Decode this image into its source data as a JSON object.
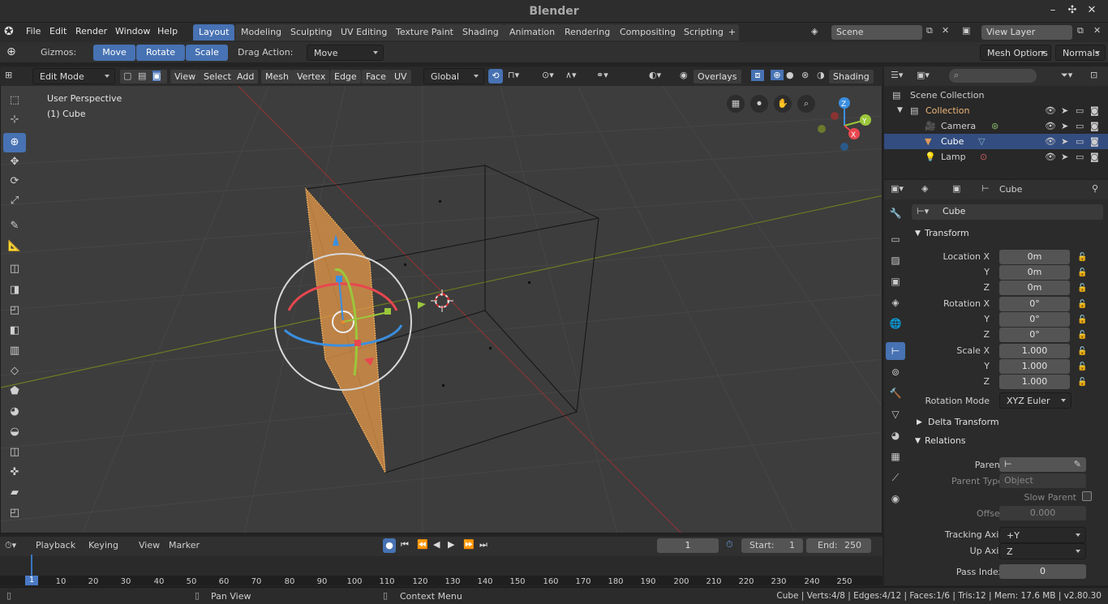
{
  "app": {
    "title": "Blender"
  },
  "menubar": {
    "items": [
      "File",
      "Edit",
      "Render",
      "Window",
      "Help"
    ]
  },
  "workspaces": [
    {
      "label": "Layout",
      "active": true
    },
    {
      "label": "Modeling"
    },
    {
      "label": "Sculpting"
    },
    {
      "label": "UV Editing"
    },
    {
      "label": "Texture Paint"
    },
    {
      "label": "Shading"
    },
    {
      "label": "Animation"
    },
    {
      "label": "Rendering"
    },
    {
      "label": "Compositing"
    },
    {
      "label": "Scripting"
    }
  ],
  "scene": {
    "name": "Scene",
    "view_layer": "View Layer"
  },
  "toolheader": {
    "gizmos_label": "Gizmos:",
    "move": "Move",
    "rotate": "Rotate",
    "scale": "Scale",
    "drag_label": "Drag Action:",
    "drag_value": "Move",
    "mesh_options": "Mesh Options",
    "normals": "Normals"
  },
  "viewport_header": {
    "mode": "Edit Mode",
    "menus": [
      "View",
      "Select",
      "Add",
      "Mesh",
      "Vertex",
      "Edge",
      "Face",
      "UV"
    ],
    "orientation": "Global",
    "overlays": "Overlays",
    "shading": "Shading"
  },
  "viewport": {
    "perspective": "User Perspective",
    "object": "(1) Cube"
  },
  "axes": {
    "x": "X",
    "y": "Y",
    "z": "Z"
  },
  "outliner": {
    "root": "Scene Collection",
    "collection": "Collection",
    "items": [
      {
        "name": "Camera"
      },
      {
        "name": "Cube",
        "selected": true
      },
      {
        "name": "Lamp"
      }
    ]
  },
  "properties": {
    "object_name": "Cube",
    "object_field": "Cube",
    "transform": {
      "header": "Transform",
      "location_x_label": "Location X",
      "y_label": "Y",
      "z_label": "Z",
      "location": [
        "0m",
        "0m",
        "0m"
      ],
      "rotation_x_label": "Rotation X",
      "rotation": [
        "0°",
        "0°",
        "0°"
      ],
      "scale_x_label": "Scale X",
      "scale": [
        "1.000",
        "1.000",
        "1.000"
      ],
      "rotation_mode_label": "Rotation Mode",
      "rotation_mode": "XYZ Euler"
    },
    "delta_transform": "Delta Transform",
    "relations": {
      "header": "Relations",
      "parent_label": "Parent",
      "parent_type_label": "Parent Type",
      "parent_type": "Object",
      "slow_parent_label": "Slow Parent",
      "offset_label": "Offset",
      "offset": "0.000",
      "tracking_axis_label": "Tracking Axis",
      "tracking_axis": "+Y",
      "up_axis_label": "Up Axis",
      "up_axis": "Z",
      "pass_index_label": "Pass Index",
      "pass_index": "0"
    }
  },
  "timeline": {
    "menus": [
      "Playback",
      "Keying",
      "View",
      "Marker"
    ],
    "current_frame": "1",
    "start_label": "Start:",
    "start": "1",
    "end_label": "End:",
    "end": "250",
    "ticks": [
      "1",
      "10",
      "20",
      "30",
      "40",
      "50",
      "60",
      "70",
      "80",
      "90",
      "100",
      "110",
      "120",
      "130",
      "140",
      "150",
      "160",
      "170",
      "180",
      "190",
      "200",
      "210",
      "220",
      "230",
      "240",
      "250"
    ]
  },
  "statusbar": {
    "pan": "Pan View",
    "context": "Context Menu",
    "stats": "Cube | Verts:4/8 | Edges:4/12 | Faces:1/6 | Tris:12 | Mem: 17.6 MB | v2.80.30"
  },
  "colors": {
    "accent": "#4772b3",
    "selected_face": "#e89a4a",
    "x_axis": "#e8474f",
    "y_axis": "#9bc73b",
    "z_axis": "#3b8fe0"
  }
}
